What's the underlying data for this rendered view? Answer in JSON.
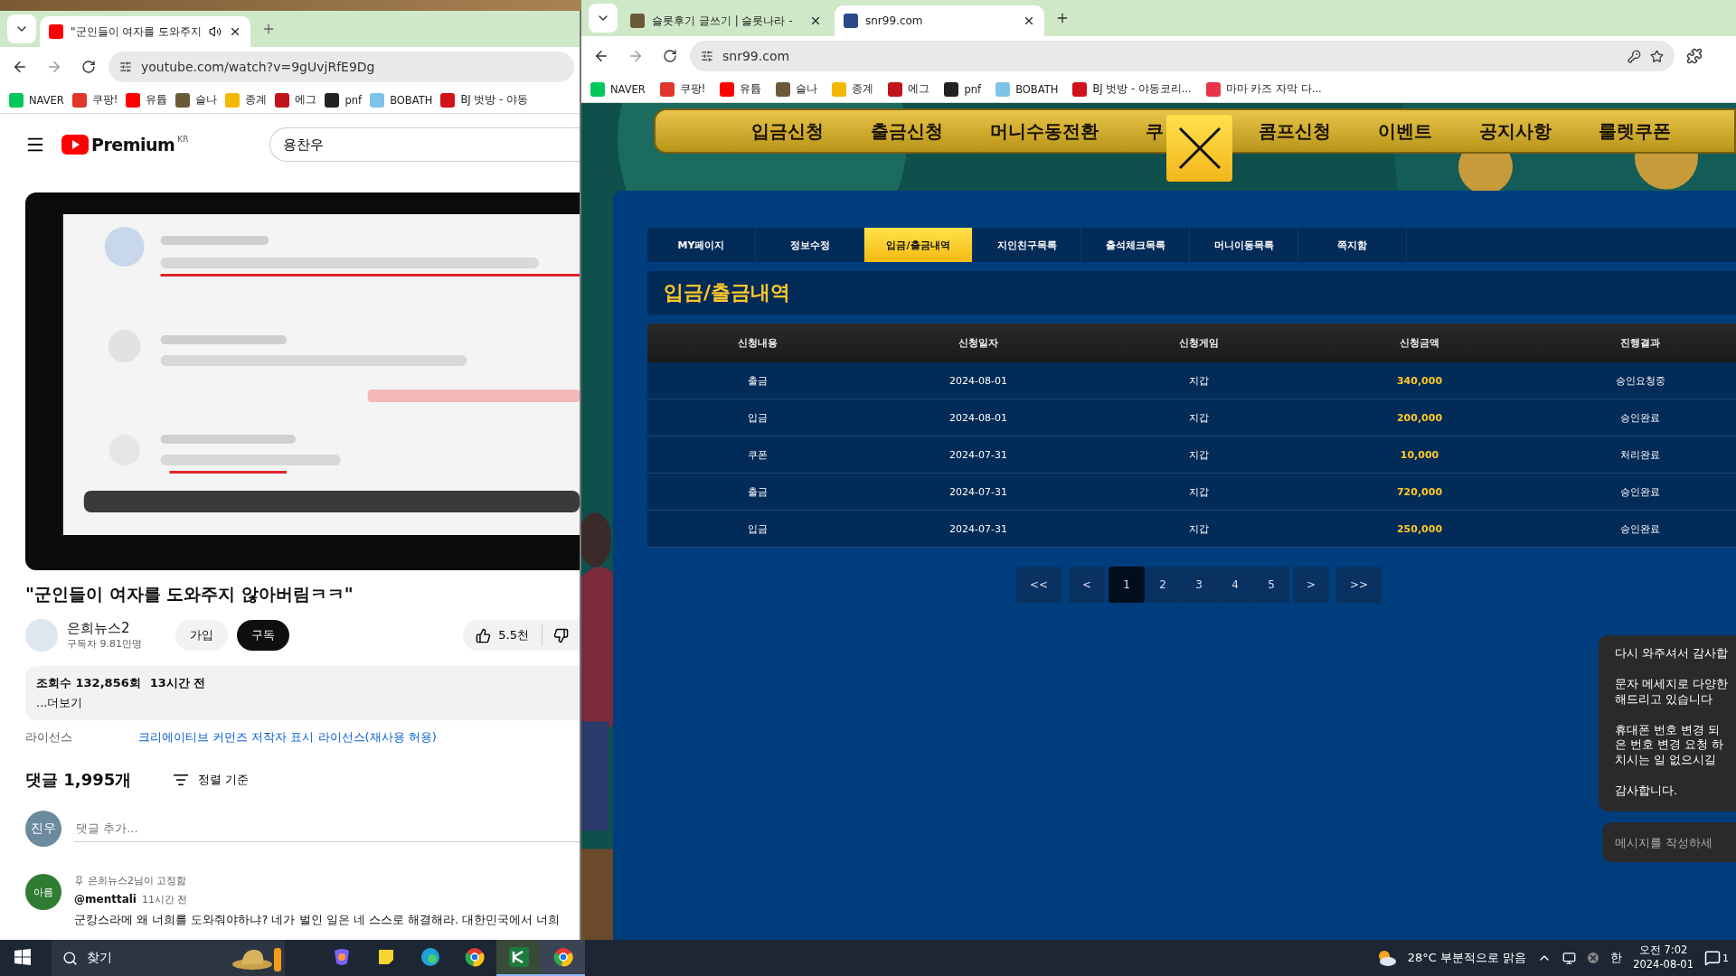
{
  "left_window": {
    "tab": {
      "title": "\"군인들이 여자를 도와주지"
    },
    "address": "youtube.com/watch?v=9gUvjRfE9Dg",
    "bookmarks": [
      {
        "label": "NAVER",
        "color": "#03c75a"
      },
      {
        "label": "쿠팡!",
        "color": "#e0362c"
      },
      {
        "label": "유튭",
        "color": "#ff0000"
      },
      {
        "label": "슬나",
        "color": "#6b5a3a"
      },
      {
        "label": "종계",
        "color": "#f5b800"
      },
      {
        "label": "에그",
        "color": "#c0141c"
      },
      {
        "label": "pnf",
        "color": "#222222"
      },
      {
        "label": "BOBATH",
        "color": "#7fc4e8"
      },
      {
        "label": "BJ 벗방 - 야동",
        "color": "#d0121b"
      }
    ],
    "youtube": {
      "logo": "Premium",
      "region": "KR",
      "search": "용찬우",
      "title": "\"군인들이 여자를 도와주지 않아버림ㅋㅋ\"",
      "channel": {
        "name": "은희뉴스2",
        "subscribers": "구독자 9.81만명"
      },
      "join": "가입",
      "subscribe": "구독",
      "likes": "5.5천",
      "views": "조회수 132,856회",
      "age": "13시간 전",
      "more": "...더보기",
      "license_label": "라이선스",
      "license_link": "크리에이티브 커먼즈 저작자 표시 라이선스(재사용 허용)",
      "comments_count": "댓글 1,995개",
      "sort": "정렬 기준",
      "my_avatar": "진우",
      "comment_placeholder": "댓글 추가...",
      "pinned": {
        "avatar": "아름",
        "pinned_by": "은희뉴스2님이 고정함",
        "author": "@menttali",
        "time": "11시간 전",
        "text": "군캉스라메 왜 너희를 도와줘야하냐? 네가 벌인 일은 네 스스로 해결해라. 대한민국에서 너희"
      }
    }
  },
  "right_window": {
    "tabs": [
      {
        "title": "슬롯후기 글쓰기 | 슬롯나라 -",
        "selected": false
      },
      {
        "title": "snr99.com",
        "selected": true
      }
    ],
    "address": "snr99.com",
    "bookmarks": [
      {
        "label": "NAVER",
        "color": "#03c75a"
      },
      {
        "label": "쿠팡!",
        "color": "#e0362c"
      },
      {
        "label": "유튭",
        "color": "#ff0000"
      },
      {
        "label": "슬나",
        "color": "#6b5a3a"
      },
      {
        "label": "종계",
        "color": "#f5b800"
      },
      {
        "label": "에그",
        "color": "#c0141c"
      },
      {
        "label": "pnf",
        "color": "#222222"
      },
      {
        "label": "BOBATH",
        "color": "#7fc4e8"
      },
      {
        "label": "BJ 벗방 - 야동코리...",
        "color": "#d0121b"
      },
      {
        "label": "마마 카즈 자막 다...",
        "color": "#e8334a"
      }
    ],
    "site": {
      "nav": [
        "입금신청",
        "출금신청",
        "머니수동전환",
        "쿠",
        "콤프신청",
        "이벤트",
        "공지사항",
        "룰렛쿠폰"
      ],
      "subtabs": [
        {
          "label": "MY페이지",
          "selected": false
        },
        {
          "label": "정보수정",
          "selected": false
        },
        {
          "label": "입금/출금내역",
          "selected": true
        },
        {
          "label": "지인친구목록",
          "selected": false
        },
        {
          "label": "출석체크목록",
          "selected": false
        },
        {
          "label": "머니이동목록",
          "selected": false
        },
        {
          "label": "쪽지함",
          "selected": false
        }
      ],
      "heading": "입금/출금내역",
      "table": {
        "columns": [
          {
            "label": "신청내용",
            "kind": "text"
          },
          {
            "label": "신청일자",
            "kind": "text"
          },
          {
            "label": "신청게임",
            "kind": "text"
          },
          {
            "label": "신청금액",
            "kind": "amount"
          },
          {
            "label": "진행결과",
            "kind": "text"
          }
        ],
        "rows": [
          [
            "출금",
            "2024-08-01",
            "지갑",
            "340,000",
            "승인요청중"
          ],
          [
            "입금",
            "2024-08-01",
            "지갑",
            "200,000",
            "승인완료"
          ],
          [
            "쿠폰",
            "2024-07-31",
            "지갑",
            "10,000",
            "처리완료"
          ],
          [
            "출금",
            "2024-07-31",
            "지갑",
            "720,000",
            "승인완료"
          ],
          [
            "입금",
            "2024-07-31",
            "지갑",
            "250,000",
            "승인완료"
          ]
        ]
      },
      "pagination": [
        {
          "label": "<<",
          "selected": false
        },
        {
          "label": "<",
          "selected": false
        },
        {
          "label": "1",
          "selected": true
        },
        {
          "label": "2",
          "selected": false
        },
        {
          "label": "3",
          "selected": false
        },
        {
          "label": "4",
          "selected": false
        },
        {
          "label": "5",
          "selected": false
        },
        {
          "label": ">",
          "selected": false
        },
        {
          "label": ">>",
          "selected": false
        }
      ],
      "chat": {
        "paragraphs": [
          "다시 와주셔서 감사합",
          "문자 메세지로 다양한\n해드리고 있습니다",
          "휴대폰 번호 변경 되\n은 번호 변경 요청 하\n치시는 일 없으시길",
          "감사합니다."
        ],
        "placeholder": "메시지를 작성하세"
      }
    }
  },
  "taskbar": {
    "search": "찾기",
    "weather": "28°C 부분적으로 맑음",
    "ime": "한",
    "time": "오전 7:02",
    "date": "2024-08-01",
    "notifications": "1"
  }
}
